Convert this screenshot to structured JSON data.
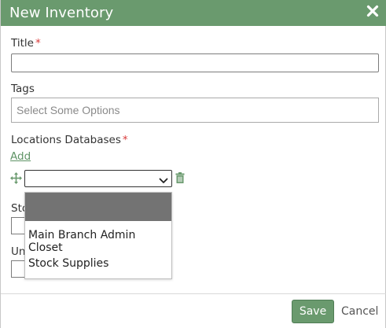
{
  "dialog": {
    "title": "New Inventory",
    "close_icon": "close-icon"
  },
  "fields": {
    "title_label": "Title",
    "title_value": "",
    "tags_label": "Tags",
    "tags_placeholder": "Select Some Options",
    "locations_label": "Locations Databases",
    "required_marker": "*",
    "add_label": "Add",
    "location_select_value": "",
    "stock_label_partial": "Sto",
    "unit_label_partial": "Un"
  },
  "location_options": [
    "",
    "Main Branch Admin Closet",
    "Stock Supplies"
  ],
  "footer": {
    "save_label": "Save",
    "cancel_label": "Cancel"
  },
  "colors": {
    "accent": "#6a9a6e",
    "required": "#d93a3a",
    "link": "#5f9466"
  }
}
